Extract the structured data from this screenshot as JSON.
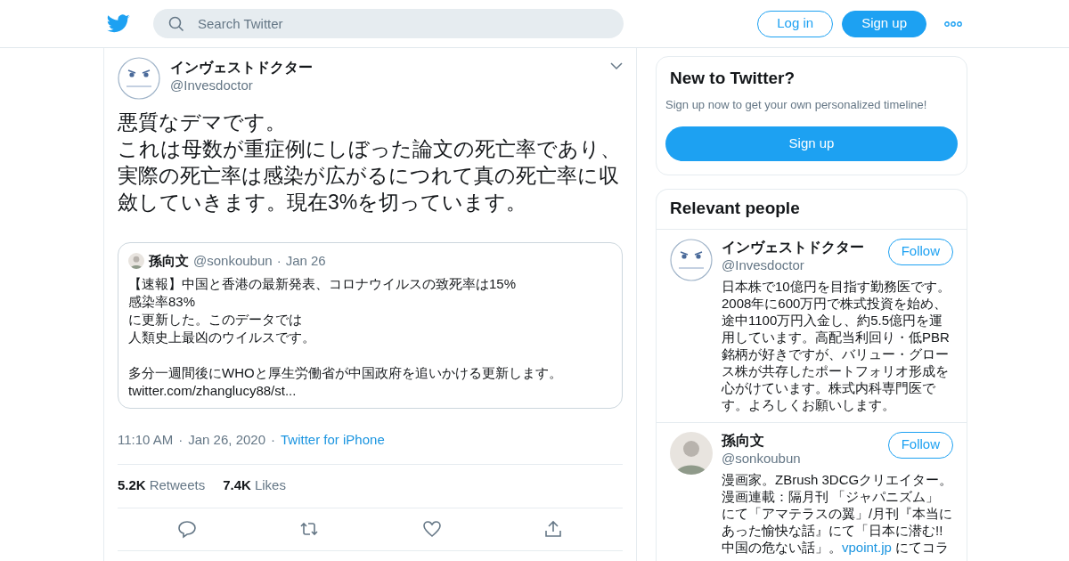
{
  "header": {
    "search": {
      "placeholder": "Search Twitter"
    },
    "buttons": [
      {
        "label": "Log in",
        "kind": "outline"
      },
      {
        "label": "Sign up",
        "kind": "filled"
      }
    ]
  },
  "tweet": {
    "author": {
      "name": "インヴェストドクター",
      "handle": "@Invesdoctor"
    },
    "paragraphs": [
      "悪質なデマです。",
      "これは母数が重症例にしぼった論文の死亡率であり、実際の死亡率は感染が広がるにつれて真の死亡率に収斂していきます。現在3%を切っています。"
    ],
    "quote": {
      "name": "孫向文",
      "handle": "@sonkoubun",
      "separator": "·",
      "date": "Jan 26",
      "blocks": [
        [
          "【速報】中国と香港の最新発表、コロナウイルスの致死率は15%",
          "感染率83%",
          "に更新した。このデータでは",
          "人類史上最凶のウイルスです。"
        ],
        [
          "多分一週間後にWHOと厚生労働省が中国政府を追いかける更新します。",
          "twitter.com/zhanglucy88/st..."
        ]
      ]
    },
    "time": "11:10 AM",
    "separator_1": "·",
    "date": "Jan 26, 2020",
    "separator_2": "·",
    "source": "Twitter for iPhone",
    "stats": [
      {
        "count": "5.2K",
        "label": "Retweets"
      },
      {
        "count": "7.4K",
        "label": "Likes"
      }
    ]
  },
  "sidebar": {
    "signup": {
      "title": "New to Twitter?",
      "subtitle": "Sign up now to get your own personalized timeline!",
      "button": "Sign up"
    },
    "relevant": {
      "title": "Relevant people",
      "people": [
        {
          "name": "インヴェストドクター",
          "handle": "@Invesdoctor",
          "follow": "Follow",
          "bio_lines": [
            {
              "text": "日本株で10億円を目指す勤務医です。"
            },
            {
              "text": "2008年に600万円で株式投資を始め、"
            },
            {
              "text": "途中1100万円入金し、約5.5億円を運"
            },
            {
              "text": "用しています。高配当利回り・低PBR"
            },
            {
              "text": "銘柄が好きですが、バリュー・グロー"
            },
            {
              "text": "ス株が共存したポートフォリオ形成を"
            },
            {
              "text": "心がけています。株式内科専門医で"
            },
            {
              "text": "す。よろしくお願いします。"
            }
          ]
        },
        {
          "name": "孫向文",
          "handle": "@sonkoubun",
          "follow": "Follow",
          "bio_lines": [
            {
              "text": "漫画家。ZBrush 3DCGクリエイター。"
            },
            {
              "text": "漫画連載：隔月刊 「ジャパニズム」"
            },
            {
              "text": "にて「アマテラスの翼」/月刊『本当に"
            },
            {
              "text": "あった愉快な話』にて「日本に潜む!!"
            },
            {
              "text": "中国の危ない話」。",
              "link": "vpoint.jp",
              "after": " にてコラ"
            }
          ]
        }
      ]
    }
  }
}
